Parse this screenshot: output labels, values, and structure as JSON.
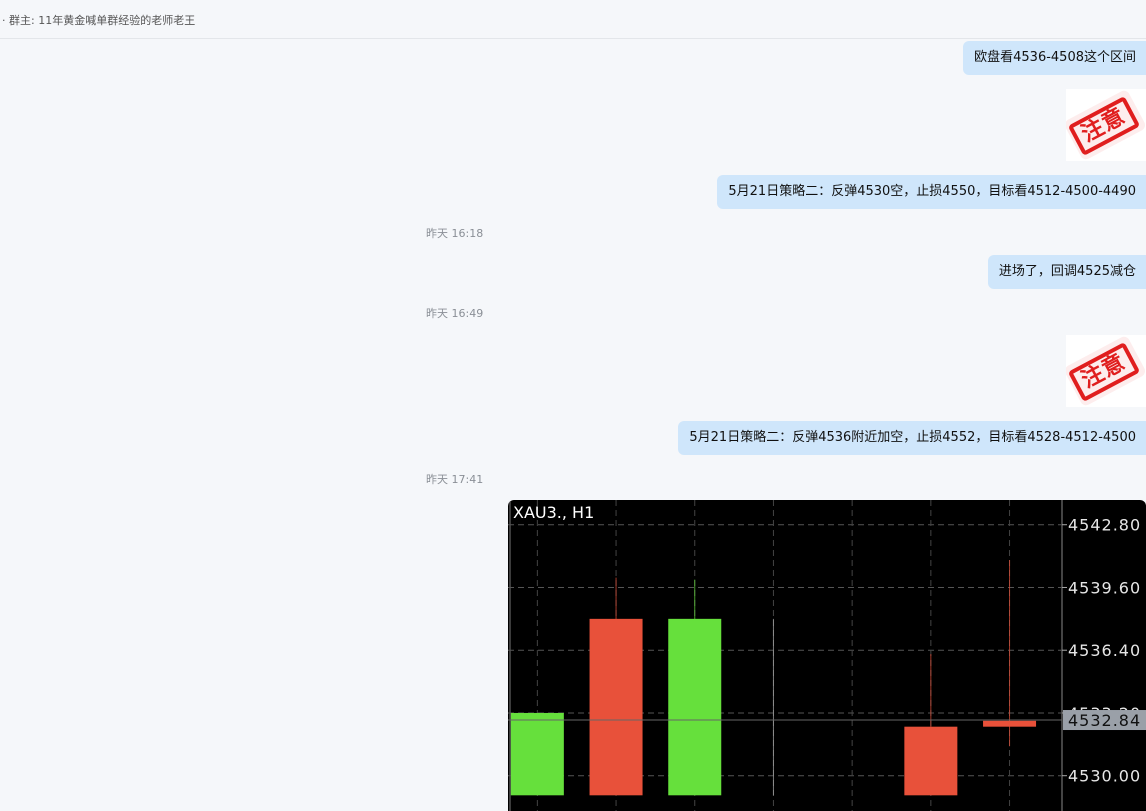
{
  "header": {
    "title": "· 群主: 11年黄金喊单群经验的老师老王"
  },
  "messages": [
    {
      "type": "text",
      "text": "欧盘看4536-4508这个区间"
    },
    {
      "type": "sticker",
      "text": "注意"
    },
    {
      "type": "text",
      "text": "5月21日策略二：反弹4530空，止损4550，目标看4512-4500-4490"
    },
    {
      "type": "time",
      "text": "昨天 16:18"
    },
    {
      "type": "text",
      "text": "进场了，回调4525减仓"
    },
    {
      "type": "time",
      "text": "昨天 16:49"
    },
    {
      "type": "sticker",
      "text": "注意"
    },
    {
      "type": "text",
      "text": "5月21日策略二：反弹4536附近加空，止损4552，目标看4528-4512-4500"
    },
    {
      "type": "time",
      "text": "昨天 17:41"
    }
  ],
  "chart_data": {
    "type": "candlestick",
    "title": "XAU3., H1",
    "price_labels": [
      "4542.80",
      "4539.60",
      "4536.40",
      "4533.20",
      "4530.00"
    ],
    "current_price": "4532.84",
    "ylim": [
      4528.2,
      4543.5
    ],
    "colors": {
      "up": "#66e03c",
      "down": "#e8513a",
      "background": "#000000",
      "grid": "#555555"
    },
    "candles": [
      {
        "direction": "up",
        "open": 4529.0,
        "close": 4533.2,
        "high": 4533.2,
        "low": 4529.0
      },
      {
        "direction": "down",
        "open": 4538.0,
        "close": 4529.0,
        "high": 4540.1,
        "low": 4529.0
      },
      {
        "direction": "up",
        "open": 4529.0,
        "close": 4538.0,
        "high": 4540.0,
        "low": 4529.0
      },
      {
        "direction": "flat",
        "open": 4538.0,
        "close": 4538.0,
        "high": 4538.0,
        "low": 4529.0
      },
      {
        "direction": "none",
        "open": null,
        "close": null,
        "high": null,
        "low": null
      },
      {
        "direction": "down",
        "open": 4532.5,
        "close": 4529.0,
        "high": 4536.2,
        "low": 4529.0
      },
      {
        "direction": "down",
        "open": 4532.8,
        "close": 4532.5,
        "high": 4541.0,
        "low": 4531.5
      }
    ]
  }
}
